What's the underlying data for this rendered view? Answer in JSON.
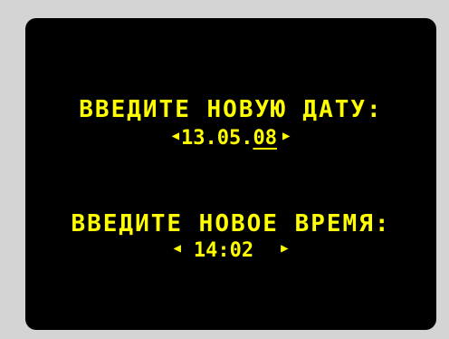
{
  "screen": {
    "date_prompt": "ВВЕДИТЕ НОВУЮ ДАТУ:",
    "date_value_prefix": "13.05.",
    "date_value_cursor": "08",
    "time_prompt": "ВВЕДИТЕ НОВОЕ ВРЕМЯ:",
    "time_value": "14:02",
    "left_arrow": "◀",
    "right_arrow": "▶"
  },
  "colors": {
    "text": "#ffff00",
    "screen_background": "#000000",
    "bezel": "#d4d4d4"
  }
}
